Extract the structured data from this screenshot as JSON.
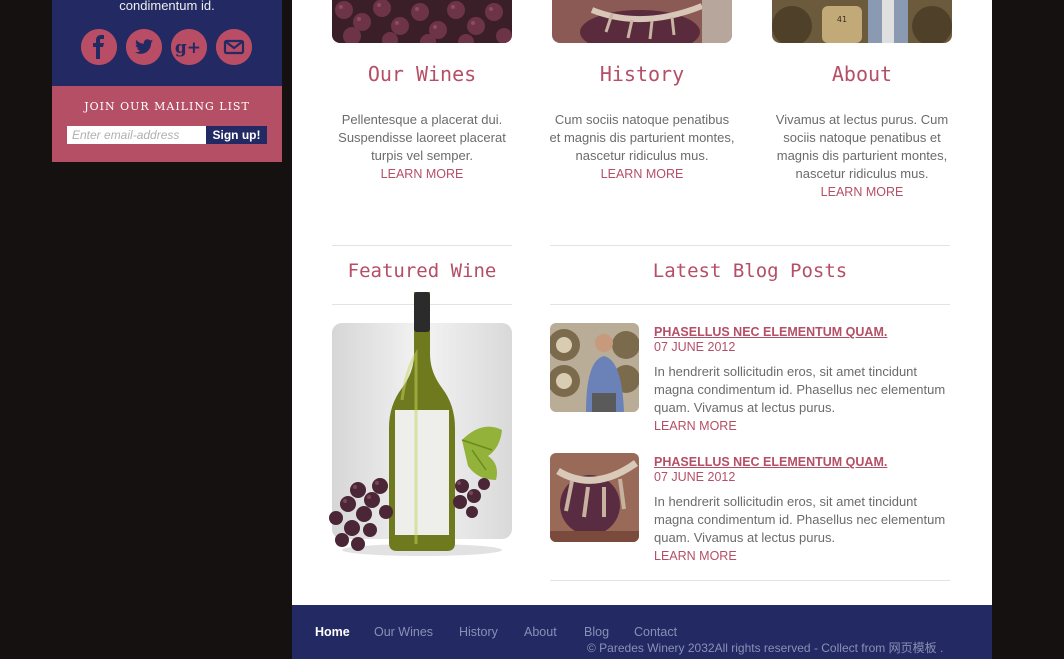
{
  "sidebar": {
    "tagline": "condimentum id.",
    "social": [
      {
        "icon": "facebook-icon",
        "glyph": "f"
      },
      {
        "icon": "twitter-icon",
        "glyph": "t"
      },
      {
        "icon": "google-plus-icon",
        "glyph": "g+"
      },
      {
        "icon": "mail-icon",
        "glyph": "✉"
      }
    ],
    "mailing": {
      "title": "JOIN OUR MAILING LIST",
      "placeholder": "Enter email-address",
      "button": "Sign up!"
    }
  },
  "features": [
    {
      "title": "Our Wines",
      "text": "Pellentesque a placerat dui. Suspendisse laoreet placerat turpis vel semper.",
      "link": "LEARN MORE"
    },
    {
      "title": "History",
      "text": "Cum sociis natoque penatibus et magnis dis parturient montes, nascetur ridiculus mus.",
      "link": "LEARN MORE"
    },
    {
      "title": "About",
      "text": "Vivamus at lectus purus. Cum sociis natoque penatibus et magnis dis parturient montes, nascetur ridiculus mus.",
      "link": "LEARN MORE"
    }
  ],
  "featured": {
    "title": "Featured Wine"
  },
  "blog": {
    "title": "Latest Blog Posts",
    "posts": [
      {
        "title": "PHASELLUS NEC ELEMENTUM QUAM.",
        "date": "07 JUNE 2012",
        "text": "In hendrerit sollicitudin eros, sit amet tincidunt magna condimentum id. Phasellus nec elementum quam. Vivamus at lectus purus.",
        "link": "LEARN MORE"
      },
      {
        "title": "PHASELLUS NEC ELEMENTUM QUAM.",
        "date": "07 JUNE 2012",
        "text": "In hendrerit sollicitudin eros, sit amet tincidunt magna condimentum id. Phasellus nec elementum quam. Vivamus at lectus purus.",
        "link": "LEARN MORE"
      }
    ]
  },
  "footer": {
    "nav": [
      "Home",
      "Our Wines",
      "History",
      "About",
      "Blog",
      "Contact"
    ],
    "active": "Home",
    "copyright": "© Paredes Winery 2032All rights reserved - Collect from 网页模板 ."
  },
  "colors": {
    "accent": "#b44f66",
    "navy": "#232a63",
    "background": "#141110"
  }
}
